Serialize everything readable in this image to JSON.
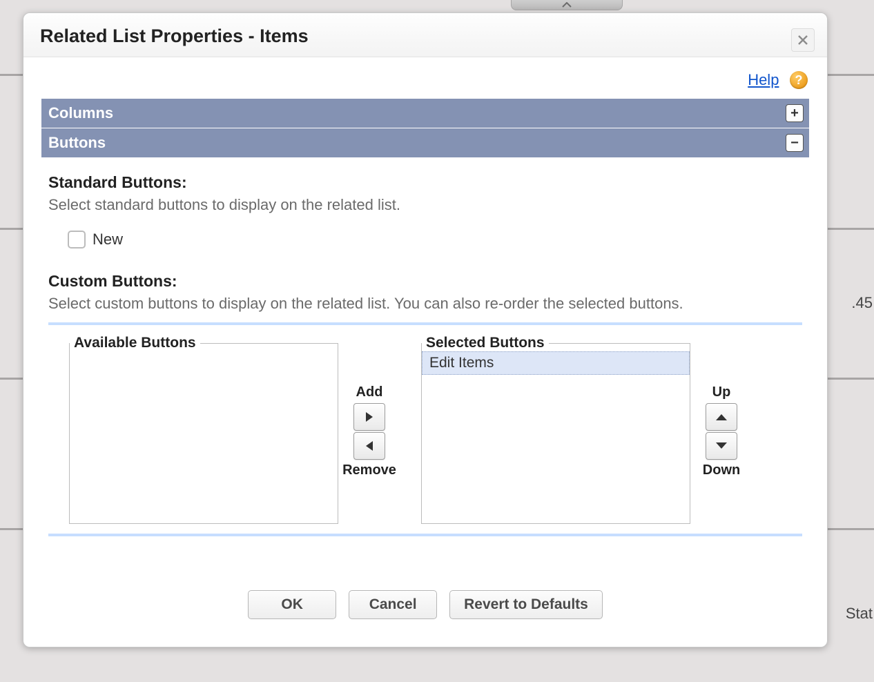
{
  "dialog": {
    "title": "Related List Properties - Items"
  },
  "help": {
    "label": "Help"
  },
  "sections": {
    "columns_label": "Columns",
    "buttons_label": "Buttons"
  },
  "standard": {
    "heading": "Standard Buttons:",
    "description": "Select standard buttons to display on the related list.",
    "new_label": "New"
  },
  "custom": {
    "heading": "Custom Buttons:",
    "description": "Select custom buttons to display on the related list. You can also re-order the selected buttons."
  },
  "duel": {
    "available_legend": "Available Buttons",
    "selected_legend": "Selected Buttons",
    "add_label": "Add",
    "remove_label": "Remove",
    "up_label": "Up",
    "down_label": "Down",
    "available_items": [],
    "selected_items": [
      "Edit Items"
    ]
  },
  "footer": {
    "ok": "OK",
    "cancel": "Cancel",
    "revert": "Revert to Defaults"
  },
  "background": {
    "right_decimal": ".45",
    "right_stat": "Stat"
  }
}
